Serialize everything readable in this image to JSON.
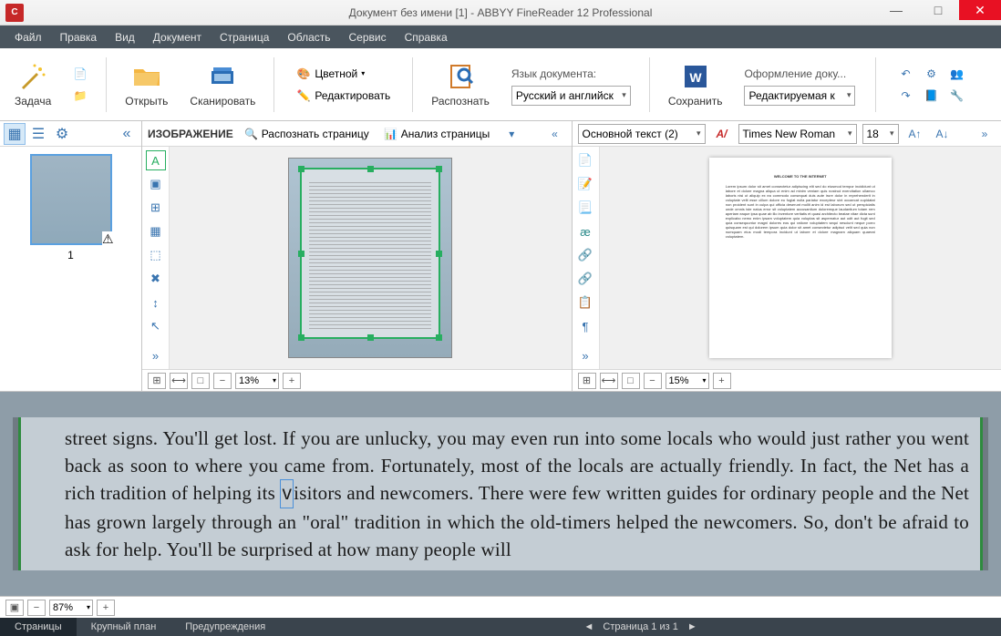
{
  "title": "Документ без имени [1] - ABBYY FineReader 12 Professional",
  "appicon_letter": "C",
  "menu": [
    "Файл",
    "Правка",
    "Вид",
    "Документ",
    "Страница",
    "Область",
    "Сервис",
    "Справка"
  ],
  "ribbon": {
    "task": "Задача",
    "open": "Открыть",
    "scan": "Сканировать",
    "color": "Цветной",
    "edit": "Редактировать",
    "recognize": "Распознать",
    "lang_label": "Язык документа:",
    "lang_value": "Русский и английск",
    "save": "Сохранить",
    "layout_label": "Оформление доку...",
    "layout_value": "Редактируемая к"
  },
  "thumbnail": {
    "page_number": "1"
  },
  "image_panel": {
    "title": "ИЗОБРАЖЕНИЕ",
    "recognize_btn": "Распознать страницу",
    "analyze_btn": "Анализ страницы",
    "zoom": "13%"
  },
  "text_panel": {
    "style": "Основной текст (2)",
    "font": "Times New Roman",
    "size": "18",
    "zoom": "15%"
  },
  "closeup": {
    "zoom": "87%",
    "text": "street signs. You'll get lost. If you are unlucky, you may even run into some locals who would just rather you went back as soon to where you came from. Fortunately, most of the locals are actually friendly. In fact, the Net has a rich tradition of helping its visitors and newcomers. There were few written guides for ordinary people and the Net has grown largely through an \"oral\" tradition in which the old-timers helped the newcomers. So, don't be afraid to ask for help. You'll be surprised at how many people will",
    "highlight_word": "v"
  },
  "status": {
    "tabs": [
      "Страницы",
      "Крупный план",
      "Предупреждения"
    ],
    "page_info": "Страница 1 из 1"
  }
}
